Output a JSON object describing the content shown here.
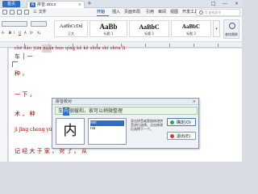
{
  "app": {
    "home_label": "首页",
    "document_name": "拼音.docx",
    "doc_icon_letter": "W",
    "close_symbol": "×",
    "add_tab_symbol": "+",
    "window_controls": [
      "□",
      "—",
      "×"
    ]
  },
  "menu": {
    "items": [
      "三 文件",
      "插入",
      "页面布局",
      "引用",
      "审阅",
      "视图",
      "开发工具",
      "会员专享"
    ],
    "active_item": "开始",
    "search_placeholder": "Q 查找命令"
  },
  "toolbar": {
    "styles": [
      {
        "preview": "AaBbCcDd",
        "name": "正文"
      },
      {
        "preview": "AaBb",
        "name": "标题 1"
      },
      {
        "preview": "AaBbC",
        "name": "标题 2"
      },
      {
        "preview": "AaBbC",
        "name": "标题 3"
      }
    ],
    "labels": [
      "A·",
      "B",
      "I",
      "U",
      "A",
      "X²",
      "X₂"
    ],
    "more_styles": "▾",
    "find_replace_label": "查找替换"
  },
  "document": {
    "pinyin_line": "chē dào    jiān nuǎn huo    qíng kě kě shōu    shí shōu li",
    "text_lines": [
      "车 │ 一",
      "种 ，",
      "一 下 ，",
      "术 ， 种",
      "jì jīng cheng yú hua shi yú shí shi yǔ",
      "记 经 大 于 家 ， 对 了 。 从"
    ]
  },
  "dialog": {
    "title": "拼音校对",
    "close_symbol": "×",
    "input_prefix": "车",
    "input_selected": "内",
    "input_suffix": "很暖和，家可以稍微整理",
    "big_char": "内",
    "candidates": [
      "nèi",
      "nà"
    ],
    "hint": "双击拼音或直接修改拼音进行选择。点击修改后选择下一个。",
    "ok_label": "确定(O)",
    "cancel_label": "退出(E)"
  }
}
